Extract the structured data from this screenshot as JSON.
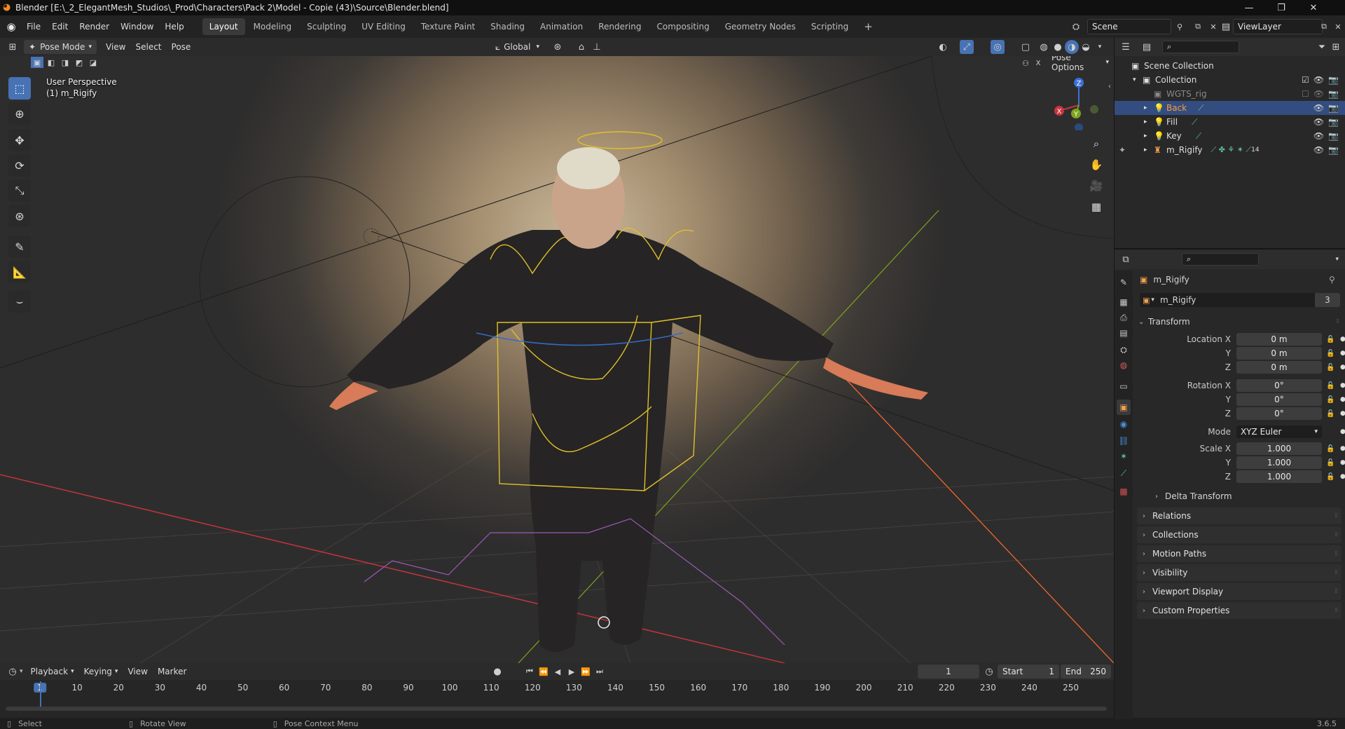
{
  "window": {
    "title": "Blender [E:\\_2_ElegantMesh_Studios\\_Prod\\Characters\\Pack 2\\Model - Copie (43)\\Source\\Blender.blend]",
    "minimize": "—",
    "maximize": "❐",
    "close": "✕"
  },
  "menu": [
    "File",
    "Edit",
    "Render",
    "Window",
    "Help"
  ],
  "workspaces": [
    "Layout",
    "Modeling",
    "Sculpting",
    "UV Editing",
    "Texture Paint",
    "Shading",
    "Animation",
    "Rendering",
    "Compositing",
    "Geometry Nodes",
    "Scripting"
  ],
  "active_workspace": "Layout",
  "add_workspace": "+",
  "scene": {
    "name": "Scene",
    "view_layer": "ViewLayer"
  },
  "viewport_header": {
    "mode": "Pose Mode",
    "menus": [
      "View",
      "Select",
      "Pose"
    ],
    "orientation": "Global",
    "pose_options": "Pose Options"
  },
  "viewport": {
    "perspective": "User Perspective",
    "object": "(1) m_Rigify",
    "axis_labels": {
      "x": "X",
      "y": "Y",
      "z": "Z"
    }
  },
  "toolbar_icons": [
    "select-box-icon",
    "cursor-icon",
    "move-icon",
    "rotate-icon",
    "scale-icon",
    "transform-icon",
    "annotate-icon",
    "measure-icon",
    "relax-icon"
  ],
  "timeline": {
    "menus": [
      "Playback",
      "Keying",
      "View",
      "Marker"
    ],
    "current_frame": "1",
    "start_label": "Start",
    "start": "1",
    "end_label": "End",
    "end": "250",
    "ticks": [
      "1",
      "10",
      "20",
      "30",
      "40",
      "50",
      "60",
      "70",
      "80",
      "90",
      "100",
      "110",
      "120",
      "130",
      "140",
      "150",
      "160",
      "170",
      "180",
      "190",
      "200",
      "210",
      "220",
      "230",
      "240",
      "250"
    ]
  },
  "statusbar": {
    "select": "Select",
    "rotate": "Rotate View",
    "context": "Pose Context Menu",
    "version": "3.6.5"
  },
  "outliner": {
    "scene_collection": "Scene Collection",
    "items": [
      {
        "name": "Collection",
        "level": 1
      },
      {
        "name": "WGTS_rig",
        "level": 2
      },
      {
        "name": "Back",
        "level": 2,
        "selected": true
      },
      {
        "name": "Fill",
        "level": 2
      },
      {
        "name": "Key",
        "level": 2
      },
      {
        "name": "m_Rigify",
        "level": 2
      }
    ],
    "badge_count": "14"
  },
  "properties": {
    "object_name": "m_Rigify",
    "data_name": "m_Rigify",
    "data_users": "3",
    "transform_label": "Transform",
    "location": {
      "label_x": "Location X",
      "label_y": "Y",
      "label_z": "Z",
      "x": "0 m",
      "y": "0 m",
      "z": "0 m"
    },
    "rotation": {
      "label_x": "Rotation X",
      "label_y": "Y",
      "label_z": "Z",
      "x": "0°",
      "y": "0°",
      "z": "0°"
    },
    "mode": {
      "label": "Mode",
      "value": "XYZ Euler"
    },
    "scale": {
      "label_x": "Scale X",
      "label_y": "Y",
      "label_z": "Z",
      "x": "1.000",
      "y": "1.000",
      "z": "1.000"
    },
    "delta_transform": "Delta Transform",
    "panels": [
      "Relations",
      "Collections",
      "Motion Paths",
      "Visibility",
      "Viewport Display",
      "Custom Properties"
    ]
  },
  "colors": {
    "accent": "#4772b3",
    "selected_row": "#334d80",
    "outliner_selected_text": "#ff9a3c",
    "x_axis": "#c8343e",
    "y_axis": "#7da41c",
    "z_axis": "#3d6fd9"
  }
}
